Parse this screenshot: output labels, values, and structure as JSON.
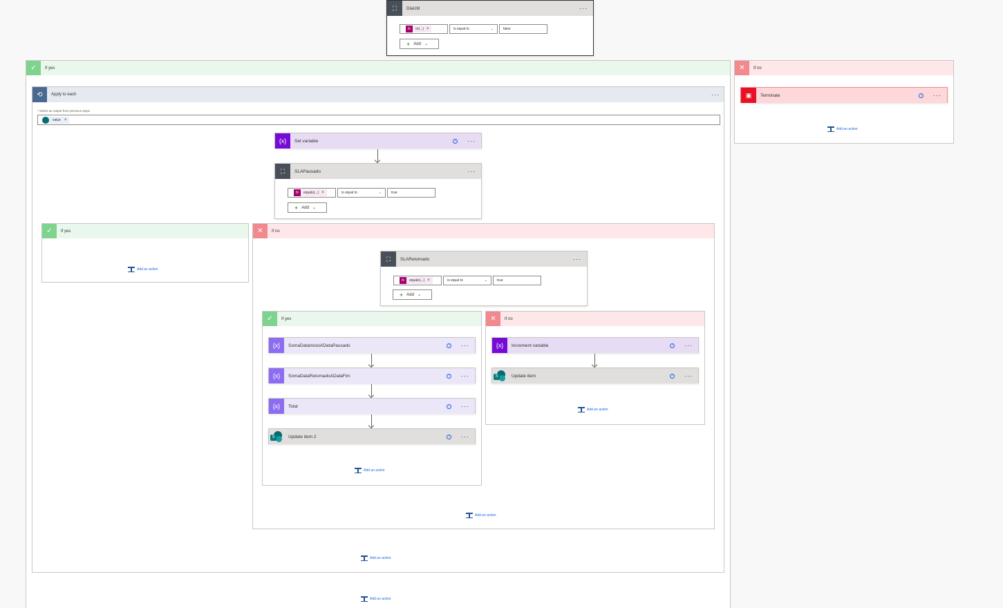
{
  "top_condition": {
    "title": "DiaUtil",
    "token": "or(...)",
    "operator": "is equal to",
    "value": "false",
    "add_label": "Add"
  },
  "if_yes_label": "If yes",
  "if_no_label": "If no",
  "add_action_label": "Add an action",
  "apply_each": {
    "title": "Apply to each",
    "select_label": "* Select an output from previous steps",
    "chip": "value"
  },
  "set_variable": {
    "title": "Set variable"
  },
  "sla_pausado": {
    "title": "SLAPausado",
    "token": "equals(...)",
    "operator": "is equal to",
    "value": "true",
    "add_label": "Add"
  },
  "sla_retomado": {
    "title": "SLARetomado",
    "token": "equals(...)",
    "operator": "is equal to",
    "value": "true",
    "add_label": "Add"
  },
  "inner_yes_actions": [
    {
      "title": "SomaDataInicioADataPausado"
    },
    {
      "title": "SomaDataRetomadoADataFim"
    },
    {
      "title": "Total"
    },
    {
      "title": "Update item 2"
    }
  ],
  "inner_no_actions": [
    {
      "title": "Increment variable"
    },
    {
      "title": "Update item"
    }
  ],
  "terminate": {
    "title": "Terminate"
  },
  "icons": {
    "condition": "condition-icon",
    "variable": "variable-icon",
    "loop": "loop-icon",
    "sharepoint": "sharepoint-icon",
    "terminate": "terminate-icon",
    "check": "check-icon",
    "close": "close-icon",
    "help": "help-icon",
    "more": "more-icon"
  },
  "colors": {
    "yes_header": "#eaf7ec",
    "yes_icon": "#7ed48f",
    "no_header": "#fde7e9",
    "no_icon": "#f1898e",
    "variable": "#770bd6",
    "soma_variable": "#8c6cf0",
    "condition": "#484f58",
    "terminate": "#e81123",
    "link": "#2266e3"
  }
}
